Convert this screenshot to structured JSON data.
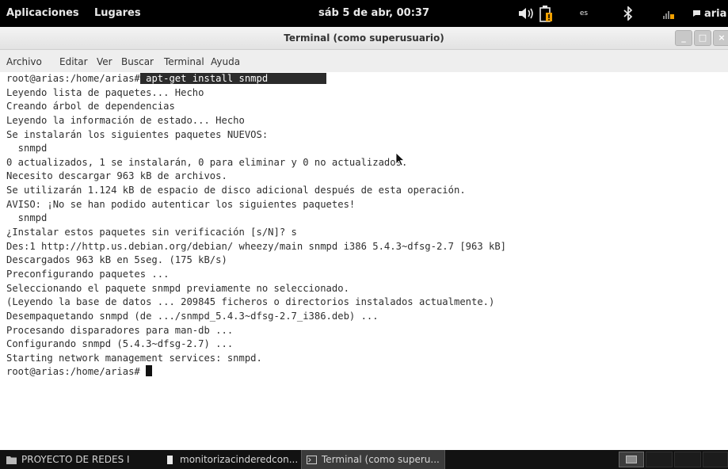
{
  "top_panel": {
    "applications": "Aplicaciones",
    "places": "Lugares",
    "clock": "sáb  5 de abr, 00:37",
    "keyboard_layout": "es",
    "user": "aria",
    "icons": [
      "volume-icon",
      "battery-icon",
      "bluetooth-icon",
      "network-icon",
      "chat-icon"
    ]
  },
  "window": {
    "title": "Terminal (como superusuario)",
    "controls": [
      "_",
      "□",
      "×"
    ]
  },
  "menubar": {
    "items": [
      "Archivo",
      "Editar",
      "Ver",
      "Buscar",
      "Terminal",
      "Ayuda"
    ]
  },
  "terminal": {
    "prompt": "root@arias:/home/arias#",
    "command": " apt-get install snmpd          ",
    "lines": [
      "Leyendo lista de paquetes... Hecho",
      "Creando árbol de dependencias",
      "Leyendo la información de estado... Hecho",
      "Se instalarán los siguientes paquetes NUEVOS:",
      "  snmpd",
      "0 actualizados, 1 se instalarán, 0 para eliminar y 0 no actualizados.",
      "Necesito descargar 963 kB de archivos.",
      "Se utilizarán 1.124 kB de espacio de disco adicional después de esta operación.",
      "AVISO: ¡No se han podido autenticar los siguientes paquetes!",
      "  snmpd",
      "¿Instalar estos paquetes sin verificación [s/N]? s",
      "Des:1 http://http.us.debian.org/debian/ wheezy/main snmpd i386 5.4.3~dfsg-2.7 [963 kB]",
      "Descargados 963 kB en 5seg. (175 kB/s)",
      "Preconfigurando paquetes ...",
      "Seleccionando el paquete snmpd previamente no seleccionado.",
      "(Leyendo la base de datos ... 209845 ficheros o directorios instalados actualmente.)",
      "Desempaquetando snmpd (de .../snmpd_5.4.3~dfsg-2.7_i386.deb) ...",
      "Procesando disparadores para man-db ...",
      "Configurando snmpd (5.4.3~dfsg-2.7) ...",
      "Starting network management services: snmpd."
    ],
    "final_prompt": "root@arias:/home/arias# "
  },
  "taskbar": {
    "tasks": [
      {
        "label": "PROYECTO DE REDES I",
        "icon": "folder-icon"
      },
      {
        "label": "monitorizacinderedcon...",
        "icon": "document-icon"
      },
      {
        "label": "Terminal (como superu...",
        "icon": "terminal-icon"
      }
    ]
  },
  "colors": {
    "panel_bg": "#000000",
    "selection_bg": "#2b2b2b",
    "taskbar_bg": "#121212",
    "battery_warning": "#f0a000"
  }
}
